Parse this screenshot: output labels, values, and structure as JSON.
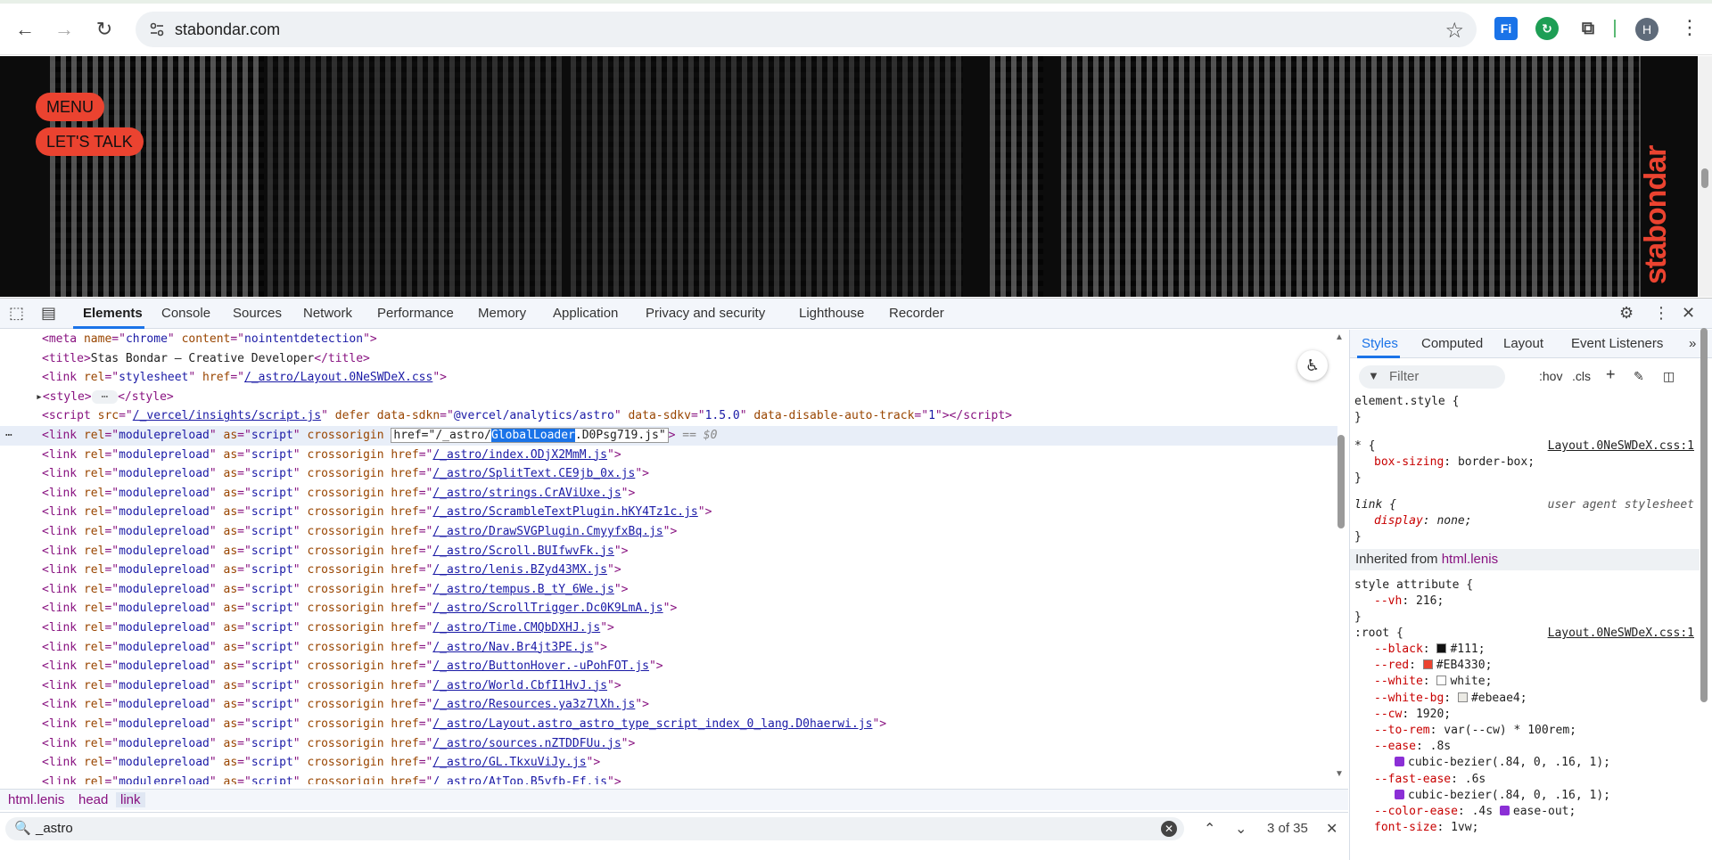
{
  "browser": {
    "url": "stabondar.com",
    "avatar_letter": "H",
    "ext_label": "Fi"
  },
  "site": {
    "menu_label": "MENU",
    "talk_label": "LET'S TALK",
    "logo_text": "stabondar",
    "accent": "#EB4330"
  },
  "devtools": {
    "tabs": [
      "Elements",
      "Console",
      "Sources",
      "Network",
      "Performance",
      "Memory",
      "Application",
      "Privacy and security",
      "Lighthouse",
      "Recorder"
    ],
    "breadcrumbs": [
      "html.lenis",
      "head",
      "link"
    ],
    "search": {
      "value": "_astro",
      "count": "3 of 35"
    },
    "elements": {
      "meta": {
        "name": "chrome",
        "content": "nointentdetection"
      },
      "title": "Stas Bondar – Creative Developer",
      "stylesheet_href": "/_astro/Layout.0NeSWDeX.css",
      "script_src": "/_vercel/insights/script.js",
      "script_sdkn": "@vercel/analytics/astro",
      "script_sdkv": "1.5.0",
      "script_auto_track": "1",
      "selected_href_prefix": "/_astro/",
      "selected_href_match": "GlobalLoader",
      "selected_href_suffix": ".D0Psg719.js",
      "selected_marker": "== $0",
      "preload_hrefs": [
        "/_astro/index.ODjX2MmM.js",
        "/_astro/SplitText.CE9jb_0x.js",
        "/_astro/strings.CrAViUxe.js",
        "/_astro/ScrambleTextPlugin.hKY4Tz1c.js",
        "/_astro/DrawSVGPlugin.CmyyfxBq.js",
        "/_astro/Scroll.BUIfwvFk.js",
        "/_astro/lenis.BZyd43MX.js",
        "/_astro/tempus.B_tY_6We.js",
        "/_astro/ScrollTrigger.Dc0K9LmA.js",
        "/_astro/Time.CMQbDXHJ.js",
        "/_astro/Nav.Br4jt3PE.js",
        "/_astro/ButtonHover.-uPohFOT.js",
        "/_astro/World.CbfI1HvJ.js",
        "/_astro/Resources.ya3z7lXh.js",
        "/_astro/Layout.astro_astro_type_script_index_0_lang.D0haerwi.js",
        "/_astro/sources.nZTDDFUu.js",
        "/_astro/GL.TkxuViJy.js",
        "/_astro/AtTop.B5yfb-Ef.js"
      ]
    },
    "styles": {
      "tabs": [
        "Styles",
        "Computed",
        "Layout",
        "Event Listeners"
      ],
      "filter_placeholder": "Filter",
      "hov": ":hov",
      "cls": ".cls",
      "element_style": "element.style {",
      "star_rule": {
        "selector": "* {",
        "source": "Layout.0NeSWDeX.css:1",
        "prop": "box-sizing",
        "value": "border-box;"
      },
      "link_rule": {
        "selector": "link {",
        "source": "user agent stylesheet",
        "prop": "display",
        "value": "none;"
      },
      "inherited_label": "Inherited from",
      "inherited_from": "html.lenis",
      "style_attr": {
        "selector": "style attribute {",
        "prop": "--vh",
        "value": "216;"
      },
      "root_rule": {
        "selector": ":root {",
        "source": "Layout.0NeSWDeX.css:1",
        "vars": [
          {
            "prop": "--black",
            "value": "#111;",
            "swatch": "#111111"
          },
          {
            "prop": "--red",
            "value": "#EB4330;",
            "swatch": "#EB4330"
          },
          {
            "prop": "--white",
            "value": "white;",
            "swatch": "#ffffff"
          },
          {
            "prop": "--white-bg",
            "value": "#ebeae4;",
            "swatch": "#ebeae4"
          },
          {
            "prop": "--cw",
            "value": "1920;"
          },
          {
            "prop": "--to-rem",
            "value": "var(--cw) * 100rem;"
          },
          {
            "prop": "--ease",
            "value": ".8s"
          },
          {
            "prop": "",
            "value": "cubic-bezier(.84, 0, .16, 1);",
            "curve": true
          },
          {
            "prop": "--fast-ease",
            "value": ".6s"
          },
          {
            "prop": "",
            "value": "cubic-bezier(.84, 0, .16, 1);",
            "curve": true
          },
          {
            "prop": "--color-ease",
            "value": ".4s",
            "extra": "ease-out;"
          },
          {
            "prop": "font-size",
            "value": "1vw;",
            "plain": true
          }
        ]
      }
    }
  }
}
